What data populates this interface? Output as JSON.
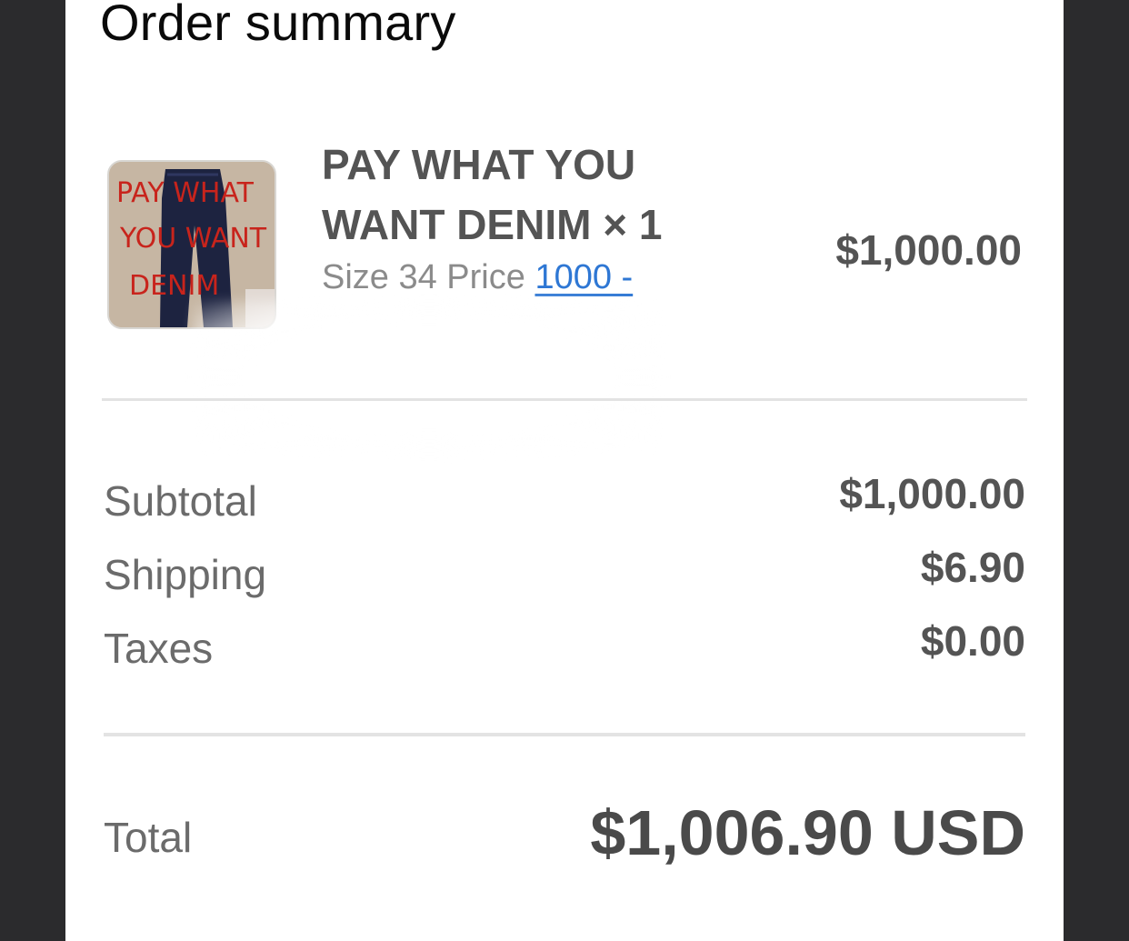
{
  "heading": "Order summary",
  "item": {
    "name": "PAY WHAT YOU WANT DENIM × 1",
    "variant_prefix": "Size 34 Price",
    "variant_link": "1000 -",
    "price": "$1,000.00",
    "thumbnail_icon": "denim-product-image",
    "thumbnail_text": [
      "PAY WHAT",
      "YOU WANT",
      "DENIM"
    ]
  },
  "summary": {
    "subtotal_label": "Subtotal",
    "subtotal_value": "$1,000.00",
    "shipping_label": "Shipping",
    "shipping_value": "$6.90",
    "taxes_label": "Taxes",
    "taxes_value": "$0.00"
  },
  "total": {
    "label": "Total",
    "value": "$1,006.90 USD"
  },
  "colors": {
    "link": "#2e77d4",
    "text_primary": "#545454",
    "text_secondary": "#6b6b6b",
    "backdrop": "#2b2b2d"
  }
}
